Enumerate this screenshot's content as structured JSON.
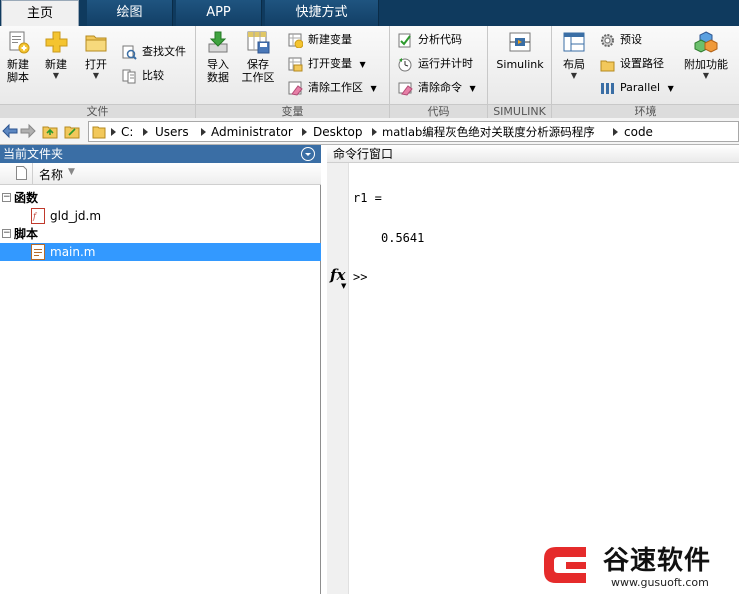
{
  "tabs": [
    {
      "label": "主页",
      "active": true
    },
    {
      "label": "绘图",
      "active": false
    },
    {
      "label": "APP",
      "active": false
    },
    {
      "label": "快捷方式",
      "active": false
    }
  ],
  "ribbon": {
    "file_group": {
      "label": "文件",
      "new_script": "新建\n脚本",
      "new": "新建",
      "open": "打开",
      "find_files": "查找文件",
      "compare": "比较"
    },
    "variable_group": {
      "label": "变量",
      "import_data": "导入\n数据",
      "save_workspace": "保存\n工作区",
      "new_variable": "新建变量",
      "open_variable": "打开变量",
      "clear_workspace": "清除工作区"
    },
    "code_group": {
      "label": "代码",
      "analyze_code": "分析代码",
      "run_and_time": "运行并计时",
      "clear_commands": "清除命令"
    },
    "simulink_group": {
      "label": "SIMULINK",
      "simulink": "Simulink"
    },
    "environment_group": {
      "label": "环境",
      "layout": "布局",
      "preferences": "预设",
      "set_path": "设置路径",
      "parallel": "Parallel",
      "add_ons": "附加功能"
    }
  },
  "address": {
    "crumbs": [
      "C:",
      "Users",
      "Administrator",
      "Desktop",
      "matlab编程灰色绝对关联度分析源码程序",
      "code"
    ]
  },
  "left_panel": {
    "title": "当前文件夹",
    "column_name": "名称",
    "groups": [
      {
        "label": "函数",
        "files": [
          "gld_jd.m"
        ]
      },
      {
        "label": "脚本",
        "files": [
          "main.m"
        ]
      }
    ]
  },
  "command_window": {
    "title": "命令行窗口",
    "lines": [
      "r1 =",
      "0.5641"
    ],
    "prompt": ">>",
    "fx_label": "fx"
  },
  "watermark": {
    "title": "谷速软件",
    "url": "www.gusuoft.com"
  },
  "colors": {
    "tab_bar": "#0f3a5e",
    "panel_header": "#3a6ea5",
    "selection": "#3399ff",
    "watermark_red": "#e52b2b"
  }
}
